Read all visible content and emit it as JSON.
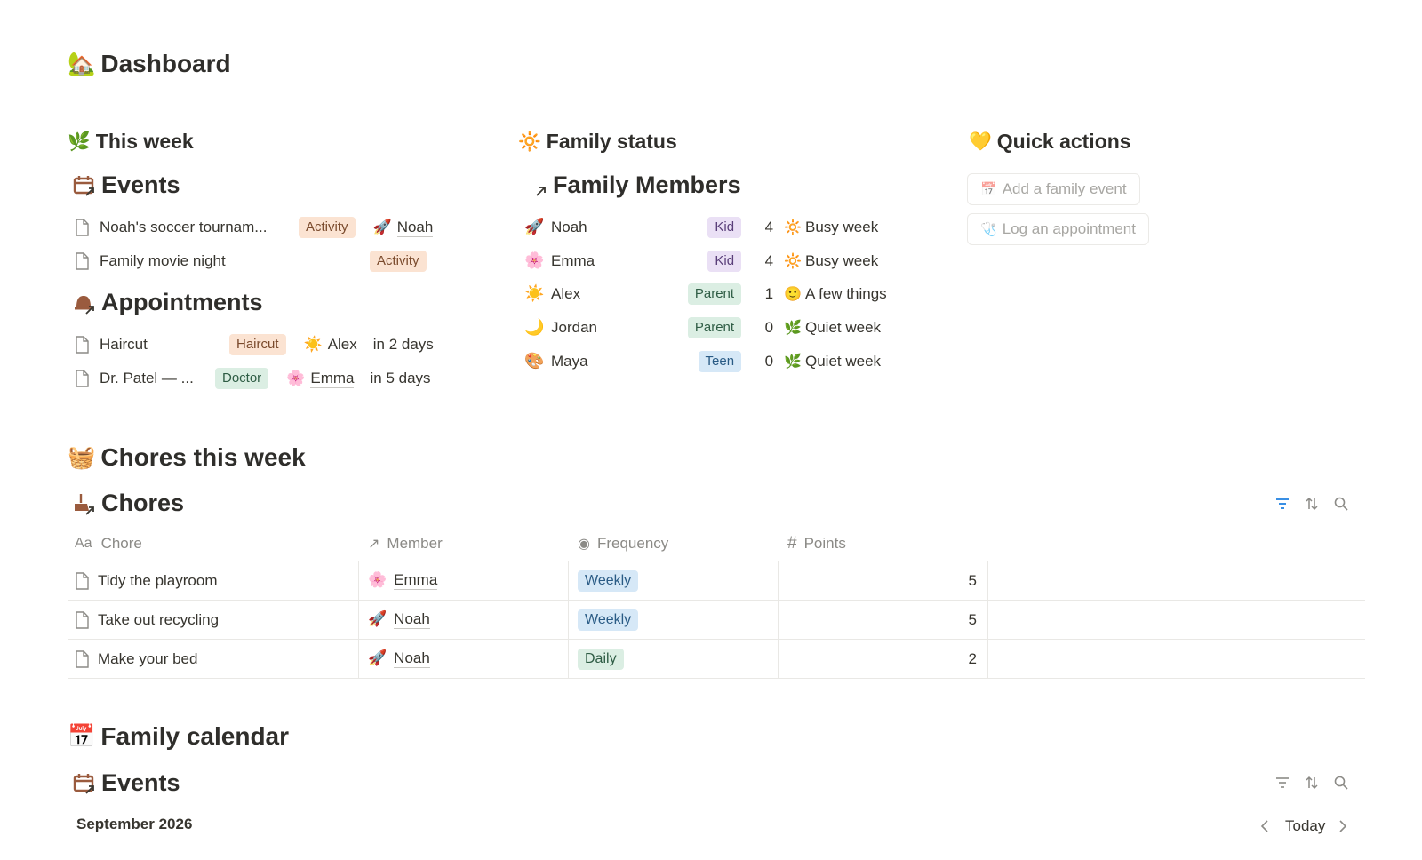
{
  "page": {
    "title": "Dashboard",
    "title_icon": "🏡"
  },
  "this_week": {
    "heading": "This week",
    "heading_icon": "🌿",
    "events": {
      "heading": "Events",
      "items": [
        {
          "title": "Noah's soccer tournam...",
          "tag": "Activity",
          "member_icon": "🚀",
          "member": "Noah"
        },
        {
          "title": "Family movie night",
          "tag": "Activity",
          "member_icon": "",
          "member": ""
        }
      ]
    },
    "appointments": {
      "heading": "Appointments",
      "items": [
        {
          "title": "Haircut",
          "tag": "Haircut",
          "member_icon": "☀️",
          "member": "Alex",
          "when": "in 2 days"
        },
        {
          "title": "Dr. Patel — ...",
          "tag": "Doctor",
          "member_icon": "🌸",
          "member": "Emma",
          "when": "in 5 days"
        }
      ]
    }
  },
  "family_status": {
    "heading": "Family status",
    "heading_icon": "🔆",
    "members_heading": "Family Members",
    "members": [
      {
        "icon": "🚀",
        "name": "Noah",
        "role": "Kid",
        "count": "4",
        "status_icon": "🔆",
        "status": "Busy week"
      },
      {
        "icon": "🌸",
        "name": "Emma",
        "role": "Kid",
        "count": "4",
        "status_icon": "🔆",
        "status": "Busy week"
      },
      {
        "icon": "☀️",
        "name": "Alex",
        "role": "Parent",
        "count": "1",
        "status_icon": "🙂",
        "status": "A few things"
      },
      {
        "icon": "🌙",
        "name": "Jordan",
        "role": "Parent",
        "count": "0",
        "status_icon": "🌿",
        "status": "Quiet week"
      },
      {
        "icon": "🎨",
        "name": "Maya",
        "role": "Teen",
        "count": "0",
        "status_icon": "🌿",
        "status": "Quiet week"
      }
    ]
  },
  "quick_actions": {
    "heading": "Quick actions",
    "heading_icon": "💛",
    "buttons": [
      {
        "icon": "📅",
        "label": "Add a family event"
      },
      {
        "icon": "🩺",
        "label": "Log an appointment"
      }
    ]
  },
  "chores_section": {
    "heading": "Chores this week",
    "heading_icon": "🧺",
    "db_title": "Chores",
    "columns": [
      "Chore",
      "Member",
      "Frequency",
      "Points"
    ],
    "column_icons": [
      "Aa",
      "↗",
      "◉",
      "#"
    ],
    "rows": [
      {
        "chore": "Tidy the playroom",
        "member_icon": "🌸",
        "member": "Emma",
        "frequency": "Weekly",
        "points": "5"
      },
      {
        "chore": "Take out recycling",
        "member_icon": "🚀",
        "member": "Noah",
        "frequency": "Weekly",
        "points": "5"
      },
      {
        "chore": "Make your bed",
        "member_icon": "🚀",
        "member": "Noah",
        "frequency": "Daily",
        "points": "2"
      }
    ]
  },
  "calendar_section": {
    "heading": "Family calendar",
    "heading_icon": "📅",
    "db_title": "Events",
    "month": "September 2026",
    "today_label": "Today"
  },
  "colors": {
    "text": "#37352f",
    "muted": "#8b8a86",
    "accent_blue": "#2383e2"
  }
}
